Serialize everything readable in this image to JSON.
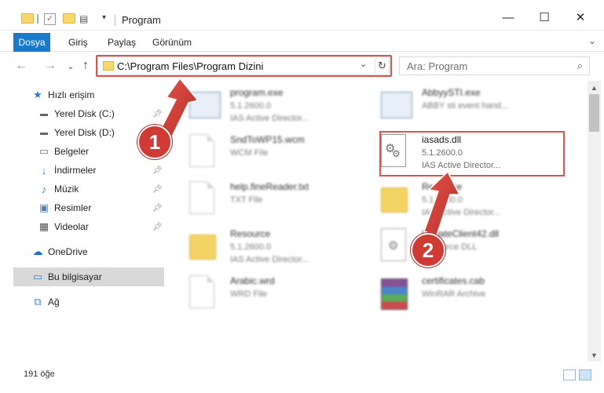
{
  "window": {
    "title": "Program",
    "minimize": "—",
    "maximize": "☐",
    "close": "✕"
  },
  "ribbon": {
    "tabs": [
      "Dosya",
      "Giriş",
      "Paylaş",
      "Görünüm"
    ],
    "expand": "⌄"
  },
  "address": {
    "path": "C:\\Program Files\\Program Dizini",
    "dropdown": "⌄",
    "refresh": "↻",
    "search_placeholder": "Ara: Program",
    "search_icon": "⌕"
  },
  "nav": {
    "back": "←",
    "forward": "→",
    "recent": "⌄",
    "up": "↑"
  },
  "sidebar": {
    "items": [
      {
        "label": "Hızlı erişim",
        "icon": "star-icon"
      },
      {
        "label": "Yerel Disk (C:)",
        "icon": "drive-icon"
      },
      {
        "label": "Yerel Disk (D:)",
        "icon": "drive-icon"
      },
      {
        "label": "Belgeler",
        "icon": "documents-icon"
      },
      {
        "label": "İndirmeler",
        "icon": "download-icon"
      },
      {
        "label": "Müzik",
        "icon": "music-icon"
      },
      {
        "label": "Resimler",
        "icon": "pictures-icon"
      },
      {
        "label": "Videolar",
        "icon": "videos-icon"
      },
      {
        "label": "OneDrive",
        "icon": "cloud-icon"
      },
      {
        "label": "Bu bilgisayar",
        "icon": "computer-icon"
      },
      {
        "label": "Ağ",
        "icon": "network-icon"
      }
    ]
  },
  "files": [
    {
      "name": "program.exe",
      "sub1": "5.1.2600.0",
      "sub2": "IAS Active Director...",
      "icon": "exe"
    },
    {
      "name": "AbbyySTI.exe",
      "sub1": "ABBY sti event hand...",
      "sub2": "",
      "icon": "exe"
    },
    {
      "name": "SndToWP15.wcm",
      "sub1": "WCM File",
      "sub2": "",
      "icon": "doc"
    },
    {
      "name": "iasads.dll",
      "sub1": "5.1.2600.0",
      "sub2": "IAS Active Director...",
      "icon": "dll"
    },
    {
      "name": "help.fineReader.txt",
      "sub1": "TXT File",
      "sub2": "",
      "icon": "doc"
    },
    {
      "name": "Resource",
      "sub1": "5.1.2600.0",
      "sub2": "IAS Active Director...",
      "icon": "folder"
    },
    {
      "name": "Resource",
      "sub1": "5.1.2600.0",
      "sub2": "IAS Active Director...",
      "icon": "folder"
    },
    {
      "name": "UpdateClient42.dll",
      "sub1": "Resource DLL",
      "sub2": "",
      "icon": "dll"
    },
    {
      "name": "Arabic.wrd",
      "sub1": "WRD File",
      "sub2": "",
      "icon": "doc"
    },
    {
      "name": "certificates.cab",
      "sub1": "WinRAR Archive",
      "sub2": "",
      "icon": "archive"
    }
  ],
  "status": {
    "count": "191 öğe"
  },
  "annotations": {
    "step1": "1",
    "step2": "2"
  },
  "colors": {
    "accent": "#1979ca",
    "highlight": "#d9534f",
    "selection": "#d9d9d9"
  }
}
